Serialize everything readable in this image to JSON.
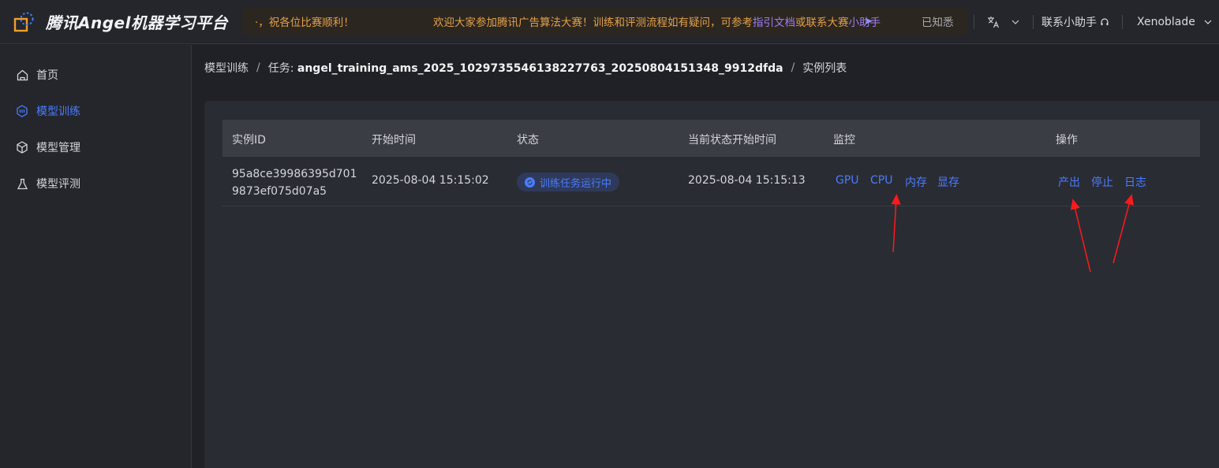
{
  "app": {
    "title": "腾讯Angel机器学习平台"
  },
  "notice": {
    "left_text": "·，祝各位比赛顺利！",
    "main_text": "欢迎大家参加腾讯广告算法大赛！训练和评测流程如有疑问，可参考",
    "link_doc": "指引文档",
    "middle_text": "或联系大赛",
    "link_helper": "小助手",
    "more_glyph": "➤",
    "dismiss": "已知悉"
  },
  "header": {
    "contact_label": "联系小助手",
    "user_name": "Xenoblade"
  },
  "sidebar": {
    "items": [
      {
        "label": "首页",
        "icon": "home-icon",
        "active": false
      },
      {
        "label": "模型训练",
        "icon": "cube-icon",
        "active": true
      },
      {
        "label": "模型管理",
        "icon": "box-icon",
        "active": false
      },
      {
        "label": "模型评测",
        "icon": "flask-icon",
        "active": false
      }
    ]
  },
  "breadcrumb": {
    "root": "模型训练",
    "task_prefix": "任务:",
    "task_id": "angel_training_ams_2025_1029735546138227763_20250804151348_9912dfda",
    "current": "实例列表"
  },
  "table": {
    "columns": [
      "实例ID",
      "开始时间",
      "状态",
      "当前状态开始时间",
      "监控",
      "操作"
    ],
    "rows": [
      {
        "instance_id": "95a8ce39986395d7019873ef075d07a5",
        "start_time": "2025-08-04 15:15:02",
        "status": "训练任务运行中",
        "status_start_time": "2025-08-04 15:15:13",
        "monitor": [
          "GPU",
          "CPU",
          "内存",
          "显存"
        ],
        "actions": [
          "产出",
          "停止",
          "日志"
        ]
      }
    ]
  },
  "colors": {
    "accent": "#4a7cff",
    "notice_text": "#e3a14a",
    "annotation_arrow": "#ff1a1a"
  }
}
